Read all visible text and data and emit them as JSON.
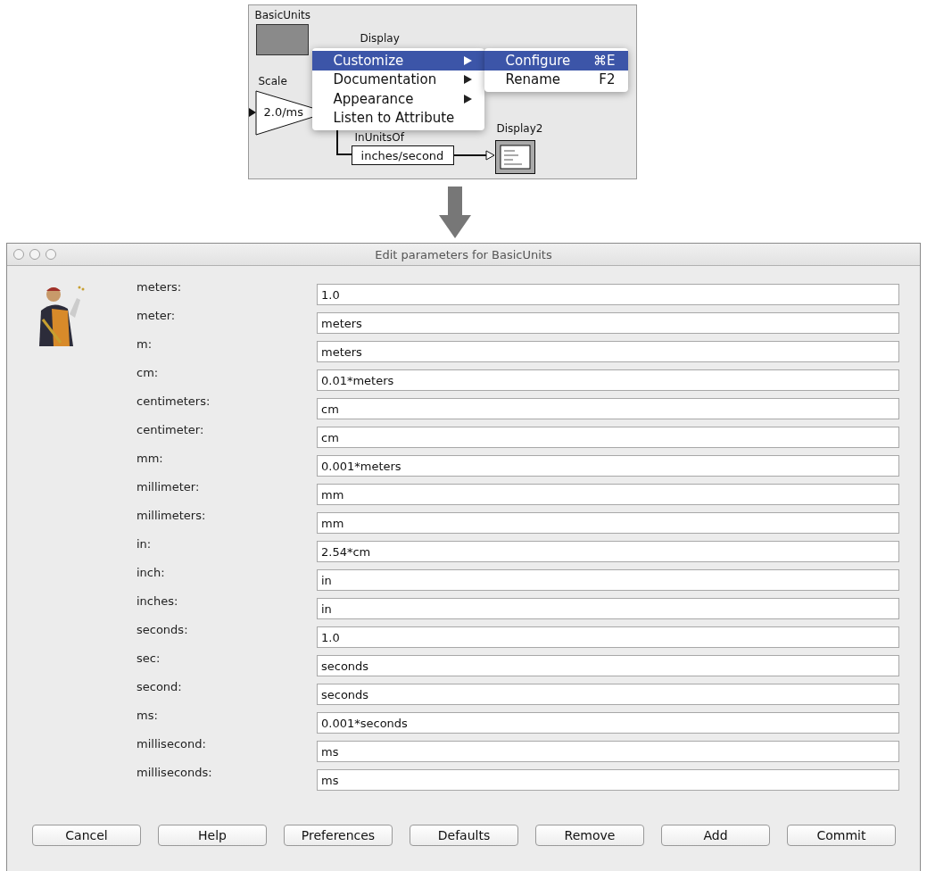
{
  "diagram": {
    "basic_units": {
      "label": "BasicUnits"
    },
    "display": {
      "label": "Display"
    },
    "scale": {
      "label": "Scale",
      "value": "2.0/ms"
    },
    "in_units_of": {
      "label": "InUnitsOf",
      "value": "inches/second"
    },
    "display2": {
      "label": "Display2"
    },
    "context_menu": [
      {
        "label": "Customize",
        "submenu": true,
        "selected": true
      },
      {
        "label": "Documentation",
        "submenu": true,
        "selected": false
      },
      {
        "label": "Appearance",
        "submenu": true,
        "selected": false
      },
      {
        "label": "Listen to Attribute",
        "submenu": false,
        "selected": false
      }
    ],
    "submenu": [
      {
        "label": "Configure",
        "shortcut": "⌘E",
        "selected": true
      },
      {
        "label": "Rename",
        "shortcut": "F2",
        "selected": false
      }
    ]
  },
  "dialog": {
    "title": "Edit parameters for BasicUnits",
    "parameters": [
      {
        "name": "meters:",
        "value": "1.0"
      },
      {
        "name": "meter:",
        "value": "meters"
      },
      {
        "name": "m:",
        "value": "meters"
      },
      {
        "name": "cm:",
        "value": "0.01*meters"
      },
      {
        "name": "centimeters:",
        "value": "cm"
      },
      {
        "name": "centimeter:",
        "value": "cm"
      },
      {
        "name": "mm:",
        "value": "0.001*meters"
      },
      {
        "name": "millimeter:",
        "value": "mm"
      },
      {
        "name": "millimeters:",
        "value": "mm"
      },
      {
        "name": "in:",
        "value": "2.54*cm"
      },
      {
        "name": "inch:",
        "value": "in"
      },
      {
        "name": "inches:",
        "value": "in"
      },
      {
        "name": "seconds:",
        "value": "1.0"
      },
      {
        "name": "sec:",
        "value": "seconds"
      },
      {
        "name": "second:",
        "value": "seconds"
      },
      {
        "name": "ms:",
        "value": "0.001*seconds"
      },
      {
        "name": "millisecond:",
        "value": "ms"
      },
      {
        "name": "milliseconds:",
        "value": "ms"
      }
    ],
    "buttons": [
      "Cancel",
      "Help",
      "Preferences",
      "Defaults",
      "Remove",
      "Add",
      "Commit"
    ]
  }
}
